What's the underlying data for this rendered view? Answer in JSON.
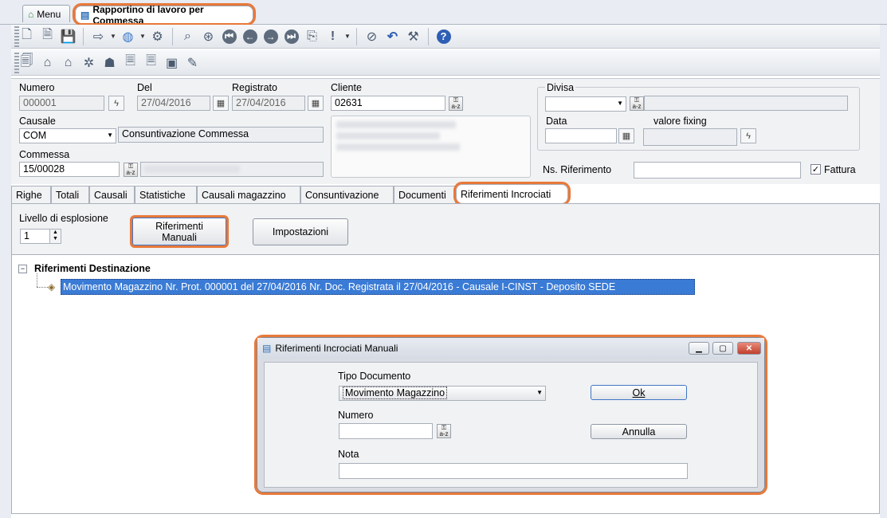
{
  "window_tabs": [
    {
      "label": "Menu"
    },
    {
      "label": "Rapportino di lavoro per Commessa"
    }
  ],
  "header": {
    "numero": {
      "label": "Numero",
      "value": "000001"
    },
    "del": {
      "label": "Del",
      "value": "27/04/2016"
    },
    "registrato": {
      "label": "Registrato",
      "value": "27/04/2016"
    },
    "cliente": {
      "label": "Cliente",
      "value": "02631"
    },
    "causale": {
      "label": "Causale",
      "value": "COM",
      "description": "Consuntivazione Commessa"
    },
    "commessa": {
      "label": "Commessa",
      "value": "15/00028"
    },
    "divisa": {
      "label": "Divisa",
      "value": ""
    },
    "data": {
      "label": "Data",
      "value": ""
    },
    "valore_fixing": {
      "label": "valore fixing",
      "value": ""
    },
    "ns_riferimento": {
      "label": "Ns. Riferimento",
      "value": ""
    },
    "fattura": {
      "label": "Fattura",
      "checked": true
    }
  },
  "tabs": [
    "Righe",
    "Totali",
    "Causali",
    "Statistiche",
    "Causali magazzino",
    "Consuntivazione",
    "Documenti",
    "Riferimenti Incrociati"
  ],
  "selected_tab": "Riferimenti Incrociati",
  "panel": {
    "livello_label": "Livello di esplosione",
    "livello_value": "1",
    "riferimenti_manuali": "Riferimenti\nManuali",
    "impostazioni": "Impostazioni"
  },
  "tree": {
    "root": "Riferimenti Destinazione",
    "items": [
      "Movimento Magazzino Nr. Prot. 000001 del 27/04/2016 Nr. Doc.  Registrata il 27/04/2016  - Causale I-CINST - Deposito SEDE"
    ]
  },
  "dialog": {
    "title": "Riferimenti Incrociati Manuali",
    "tipo_documento_label": "Tipo Documento",
    "tipo_documento_value": "Movimento Magazzino",
    "numero_label": "Numero",
    "numero_value": "",
    "nota_label": "Nota",
    "nota_value": "",
    "ok_label": "Ok",
    "annulla_label": "Annulla"
  },
  "colors": {
    "highlight": "#e8793a",
    "selection": "#3a7bd5",
    "help": "#2f5fb4"
  }
}
